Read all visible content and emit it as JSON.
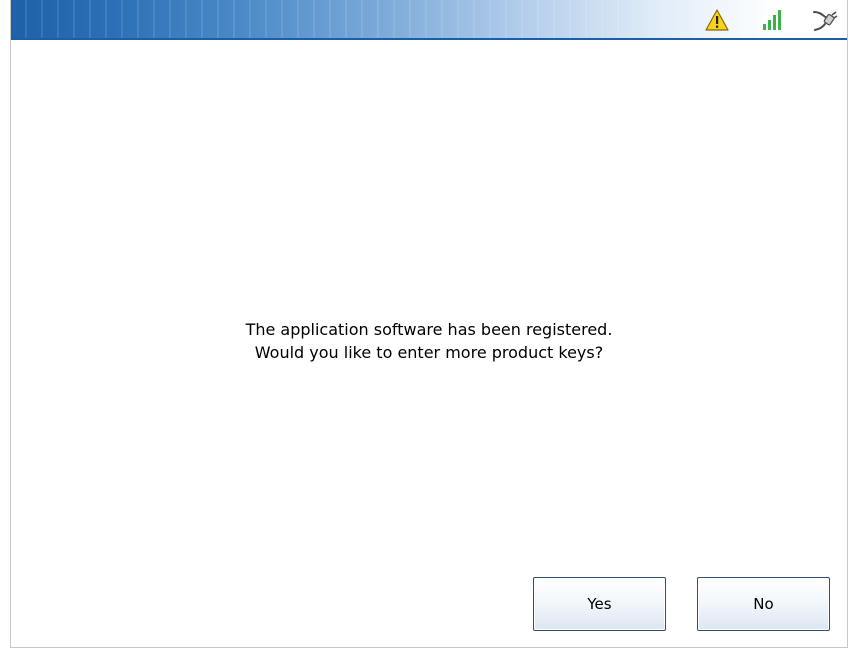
{
  "status_bar": {
    "icons": [
      "warning-icon",
      "signal-strength-icon",
      "power-plug-icon"
    ],
    "accent_color": "#1c5fa8"
  },
  "dialog": {
    "line1": "The application software has been registered.",
    "line2": "Would you like to enter more product keys?"
  },
  "buttons": {
    "yes_label": "Yes",
    "no_label": "No"
  }
}
